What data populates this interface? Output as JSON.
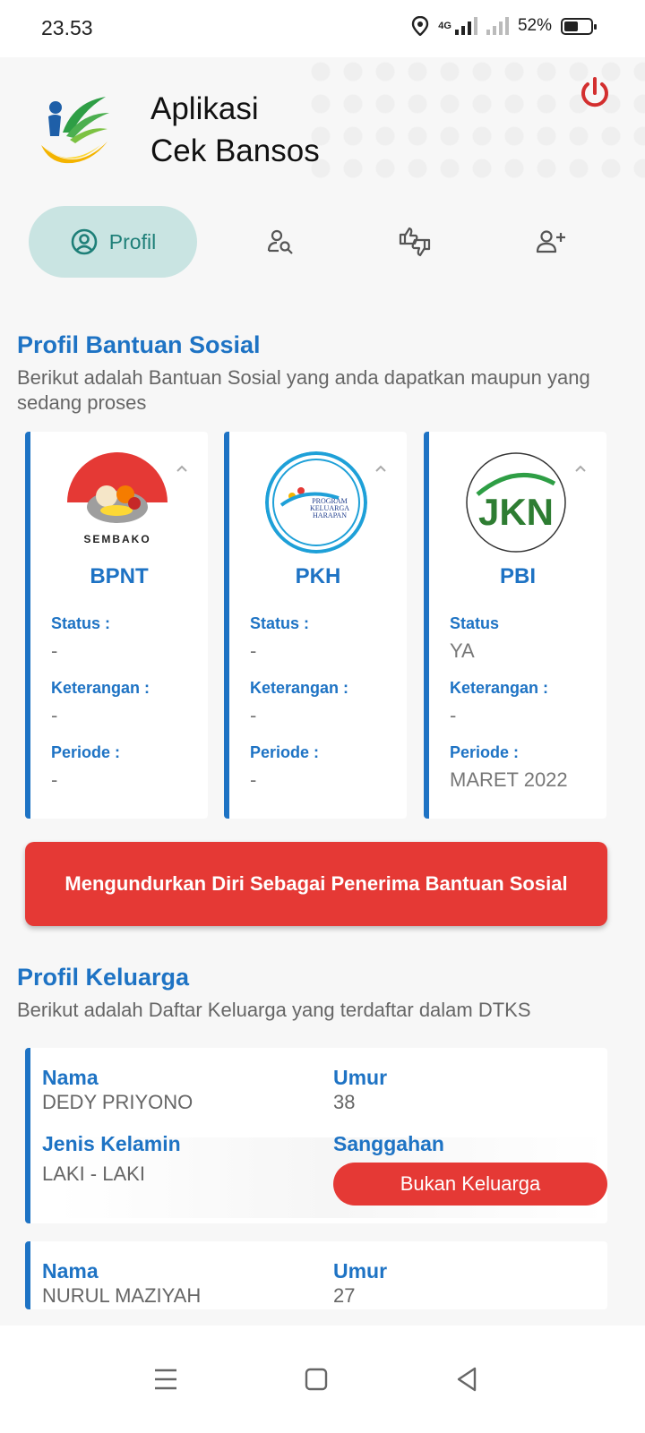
{
  "status_bar": {
    "time": "23.53",
    "network": "4G",
    "battery": "52%"
  },
  "header": {
    "title_line1": "Aplikasi",
    "title_line2": "Cek Bansos",
    "logo_icon": "kemensos-logo-icon",
    "power_icon": "power-icon",
    "power_color": "#d32f2f"
  },
  "tabs": [
    {
      "label": "Profil",
      "icon": "user-circle-icon",
      "active": true
    },
    {
      "label": "",
      "icon": "user-search-icon",
      "active": false
    },
    {
      "label": "",
      "icon": "thumbs-up-down-icon",
      "active": false
    },
    {
      "label": "",
      "icon": "user-add-icon",
      "active": false
    }
  ],
  "bansos_section": {
    "title": "Profil Bantuan Sosial",
    "subtitle": "Berikut adalah Bantuan Sosial yang anda dapatkan maupun yang sedang proses",
    "cards": [
      {
        "name": "BPNT",
        "logo": "sembako-logo-icon",
        "logo_text": "SEMBAKO",
        "status_label": "Status :",
        "status": "-",
        "keterangan_label": "Keterangan :",
        "keterangan": "-",
        "periode_label": "Periode :",
        "periode": "-"
      },
      {
        "name": "PKH",
        "logo": "pkh-logo-icon",
        "logo_text": "PROGRAM KELUARGA HARAPAN",
        "status_label": "Status :",
        "status": "-",
        "keterangan_label": "Keterangan :",
        "keterangan": "-",
        "periode_label": "Periode :",
        "periode": "-"
      },
      {
        "name": "PBI",
        "logo": "jkn-logo-icon",
        "logo_text": "JKN",
        "status_label": "Status",
        "status": "YA",
        "keterangan_label": "Keterangan :",
        "keterangan": "-",
        "periode_label": "Periode :",
        "periode": "MARET 2022"
      }
    ],
    "resign_button": "Mengundurkan Diri Sebagai Penerima Bantuan Sosial"
  },
  "family_section": {
    "title": "Profil Keluarga",
    "subtitle": "Berikut adalah Daftar Keluarga yang terdaftar dalam DTKS",
    "labels": {
      "nama": "Nama",
      "umur": "Umur",
      "jenis_kelamin": "Jenis Kelamin",
      "sanggahan": "Sanggahan"
    },
    "members": [
      {
        "nama": "DEDY PRIYONO",
        "umur": "38",
        "jenis_kelamin": "LAKI - LAKI",
        "sanggahan_button": "Bukan Keluarga"
      },
      {
        "nama": "NURUL MAZIYAH",
        "umur": "27"
      }
    ]
  },
  "colors": {
    "accent_blue": "#1e73c4",
    "danger_red": "#e53935",
    "tab_active_bg": "#c9e4e2",
    "tab_active_fg": "#1e7f78"
  },
  "nav_bar": {
    "menu_icon": "menu-icon",
    "home_icon": "home-square-icon",
    "back_icon": "back-triangle-icon"
  }
}
